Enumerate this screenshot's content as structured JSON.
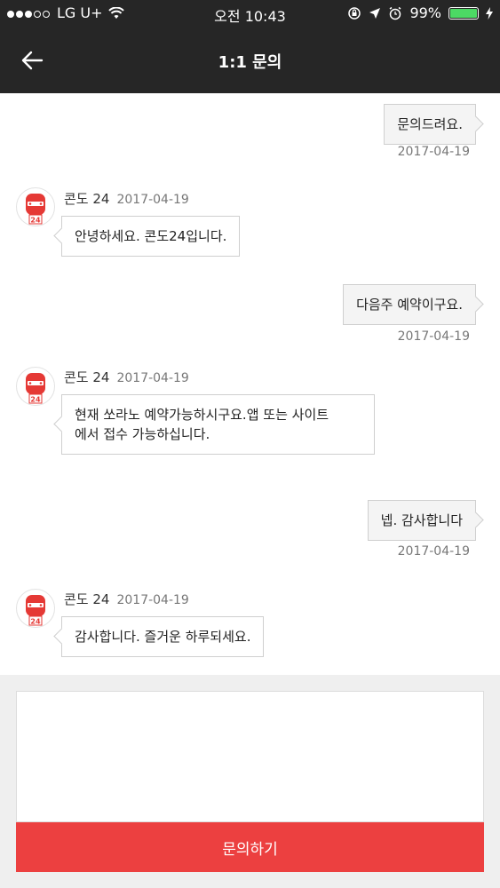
{
  "status_bar": {
    "carrier": "LG U+",
    "time": "오전 10:43",
    "battery": "99%"
  },
  "nav": {
    "back_icon": "arrow-left-icon",
    "title": "1:1 문의"
  },
  "messages": [
    {
      "direction": "out",
      "text": "문의드려요.",
      "date": "2017-04-19"
    },
    {
      "direction": "in",
      "sender": "콘도 24",
      "date": "2017-04-19",
      "text": "안녕하세요. 콘도24입니다."
    },
    {
      "direction": "out",
      "text": "다음주 예약이구요.",
      "date": "2017-04-19"
    },
    {
      "direction": "in",
      "sender": "콘도 24",
      "date": "2017-04-19",
      "text_line1": "현재 쏘라노 예약가능하시구요.앱 또는 사이트",
      "text_line2": "에서 접수 가능하십니다."
    },
    {
      "direction": "out",
      "text": "넵. 감사합니다",
      "date": "2017-04-19"
    },
    {
      "direction": "in",
      "sender": "콘도 24",
      "date": "2017-04-19",
      "text": "감사합니다. 즐거운 하루되세요."
    }
  ],
  "avatar_badge": "24",
  "composer": {
    "placeholder": "",
    "submit_label": "문의하기"
  },
  "colors": {
    "header_bg": "#262626",
    "submit_bg": "#ec4040",
    "bottom_bg": "#efefef"
  }
}
